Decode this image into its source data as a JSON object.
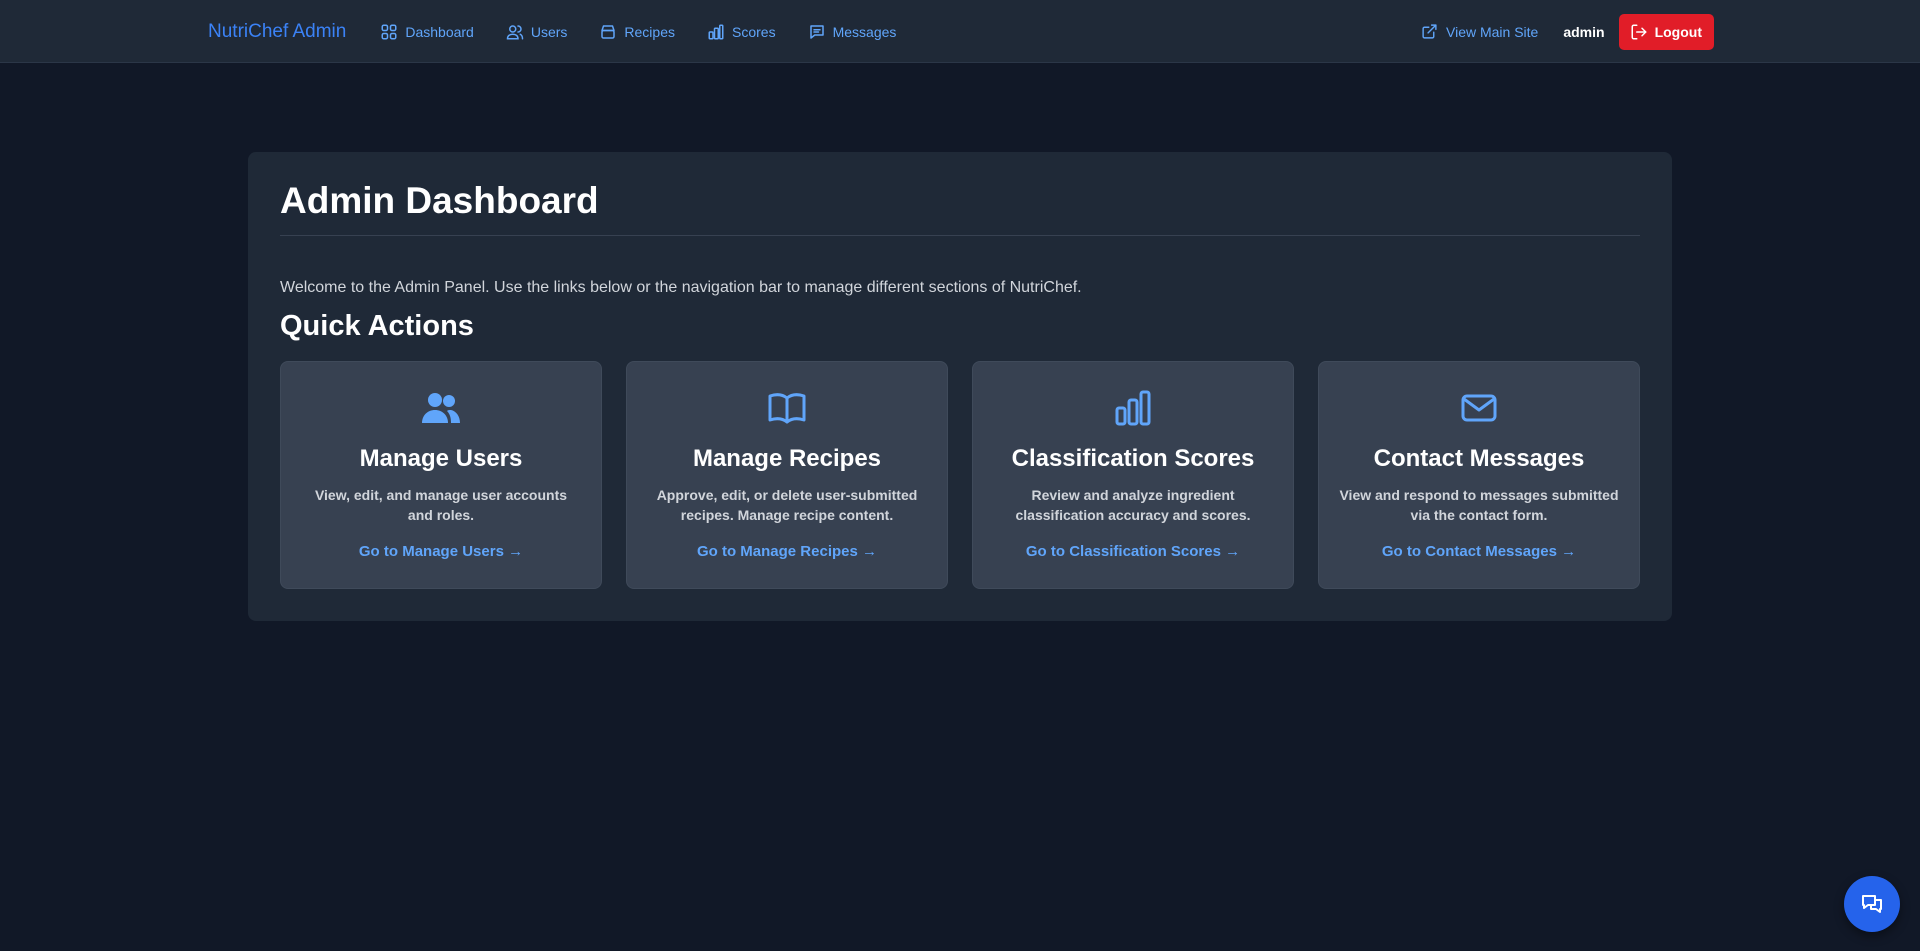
{
  "brand": "NutriChef Admin",
  "nav": {
    "items": [
      {
        "label": "Dashboard",
        "icon": "dashboard-grid-icon"
      },
      {
        "label": "Users",
        "icon": "users-icon"
      },
      {
        "label": "Recipes",
        "icon": "recipe-box-icon"
      },
      {
        "label": "Scores",
        "icon": "bar-chart-icon"
      },
      {
        "label": "Messages",
        "icon": "message-icon"
      }
    ],
    "view_site": "View Main Site",
    "username": "admin",
    "logout": "Logout"
  },
  "page": {
    "title": "Admin Dashboard",
    "welcome": "Welcome to the Admin Panel. Use the links below or the navigation bar to manage different sections of NutriChef.",
    "section_title": "Quick Actions"
  },
  "cards": [
    {
      "title": "Manage Users",
      "description": "View, edit, and manage user accounts and roles.",
      "link": "Go to Manage Users →",
      "icon": "users-icon"
    },
    {
      "title": "Manage Recipes",
      "description": "Approve, edit, or delete user-submitted recipes. Manage recipe content.",
      "link": "Go to Manage Recipes →",
      "icon": "open-book-icon"
    },
    {
      "title": "Classification Scores",
      "description": "Review and analyze ingredient classification accuracy and scores.",
      "link": "Go to Classification Scores →",
      "icon": "bar-chart-icon"
    },
    {
      "title": "Contact Messages",
      "description": "View and respond to messages submitted via the contact form.",
      "link": "Go to Contact Messages →",
      "icon": "envelope-icon"
    }
  ],
  "colors": {
    "background": "#111827",
    "surface": "#1f2937",
    "card": "#374151",
    "accent": "#60a5fa",
    "logout": "#e11d28",
    "chat": "#2563eb"
  }
}
